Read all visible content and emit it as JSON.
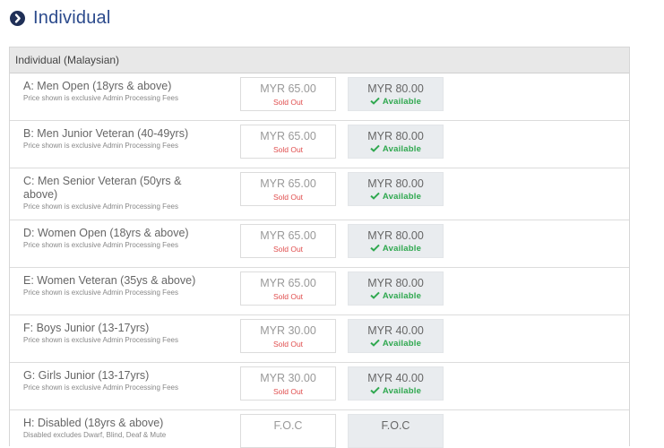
{
  "section_heading": "Individual",
  "table": {
    "header": "Individual (Malaysian)",
    "rows": [
      {
        "title": "A: Men Open (18yrs & above)",
        "note": "Price shown is exclusive Admin Processing Fees",
        "early_price": "MYR 65.00",
        "early_status": "Sold Out",
        "normal_price": "MYR 80.00",
        "normal_status": "Available"
      },
      {
        "title": "B: Men Junior Veteran (40-49yrs)",
        "note": "Price shown is exclusive Admin Processing Fees",
        "early_price": "MYR 65.00",
        "early_status": "Sold Out",
        "normal_price": "MYR 80.00",
        "normal_status": "Available"
      },
      {
        "title": "C: Men Senior Veteran (50yrs & above)",
        "note": "Price shown is exclusive Admin Processing Fees",
        "early_price": "MYR 65.00",
        "early_status": "Sold Out",
        "normal_price": "MYR 80.00",
        "normal_status": "Available"
      },
      {
        "title": "D: Women Open (18yrs & above)",
        "note": "Price shown is exclusive Admin Processing Fees",
        "early_price": "MYR 65.00",
        "early_status": "Sold Out",
        "normal_price": "MYR 80.00",
        "normal_status": "Available"
      },
      {
        "title": "E: Women Veteran (35ys & above)",
        "note": "Price shown is exclusive Admin Processing Fees",
        "early_price": "MYR 65.00",
        "early_status": "Sold Out",
        "normal_price": "MYR 80.00",
        "normal_status": "Available"
      },
      {
        "title": "F: Boys Junior (13-17yrs)",
        "note": "Price shown is exclusive Admin Processing Fees",
        "early_price": "MYR 30.00",
        "early_status": "Sold Out",
        "normal_price": "MYR 40.00",
        "normal_status": "Available"
      },
      {
        "title": "G: Girls Junior (13-17yrs)",
        "note": "Price shown is exclusive Admin Processing Fees",
        "early_price": "MYR 30.00",
        "early_status": "Sold Out",
        "normal_price": "MYR 40.00",
        "normal_status": "Available"
      },
      {
        "title": "H: Disabled (18yrs & above)",
        "note": "Disabled excludes Dwarf, Blind, Deaf & Mute",
        "early_price": "F.O.C",
        "early_status": "",
        "normal_price": "F.O.C",
        "normal_status": ""
      }
    ]
  },
  "colors": {
    "heading": "#2b4a8c",
    "sold_out": "#e04e4e",
    "available": "#2fa84f",
    "icon_bg": "#1f2f57"
  },
  "icons": {
    "heading": "chevron-right-circle-icon",
    "available": "check-icon"
  }
}
